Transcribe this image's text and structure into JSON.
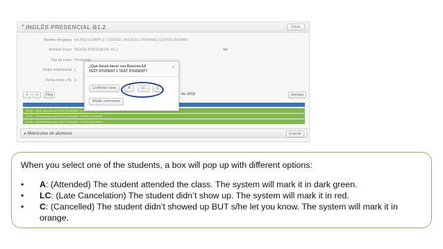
{
  "screen": {
    "title": "INGLÉS PRESENCIAL B1.2",
    "back_button": "Volver",
    "form": {
      "labels": [
        "Nombre del grupo",
        "Nombre Curso",
        "Tipo de curso",
        "Grupo empresarial",
        "Fecha inicio y fin"
      ],
      "values": [
        "AA 2016 EXAMPLE COURSE LANGSOLS TRAINING CENTRE INGMAD",
        "INGLÉS PRESENCIAL B1.2",
        "Presencial",
        "L",
        "S"
      ],
      "view_link": "Ver"
    },
    "nav": {
      "prev": "<",
      "next": ">",
      "today": "Hoy",
      "week_suffix": "de 2016",
      "week_button": "Semana"
    },
    "sessions": [
      "14:00 - 15:30 Reserva AA TEST STUDENT 1 TEST STUDENT",
      "14:00 - 15:30 Reserva AA TEST STUDENT 2 TEST STUDENT",
      "14:00 - 15:30 Reserva AA TEST STUDENT 3 TEST STUDENT"
    ],
    "students_section": "Matrículas de alumnos",
    "save_button": "Guardar",
    "popup": {
      "question": "¿Qué desea hacer con Reserva AA",
      "student": "TEST STUDENT 1 TEST STUDENT?",
      "close": "×",
      "confirm": "Confirmar clase",
      "options": [
        "A",
        "LC",
        "C"
      ],
      "add_comment": "Añadir comentario"
    }
  },
  "callout": {
    "intro": "When you select one of the students, a box will pop up with different options:",
    "bullet": "•",
    "items": [
      {
        "code": "A",
        "text": ": (Attended) The student attended the class. The system will mark it in dark green."
      },
      {
        "code": "LC",
        "text": ": (Late Cancelation) The student didn’t show up. The system will mark it in red."
      },
      {
        "code": "C",
        "text": ": (Cancelled) The student didn’t showed up BUT s/he let you know. The system will mark it in",
        "text2": "orange."
      }
    ]
  },
  "colors": {
    "dark_green": "#82b84d",
    "blue": "#3e73b2",
    "highlight": "#28418a",
    "callout_border": "#b3a26b"
  }
}
